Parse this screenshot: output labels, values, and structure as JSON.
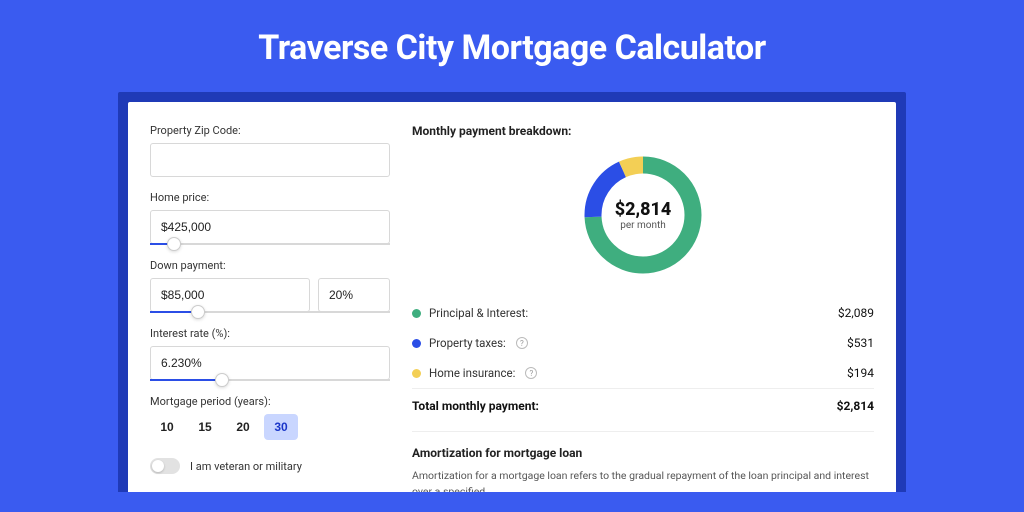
{
  "page": {
    "title": "Traverse City Mortgage Calculator"
  },
  "form": {
    "zip_label": "Property Zip Code:",
    "zip_value": "",
    "home_price_label": "Home price:",
    "home_price_value": "$425,000",
    "home_price_slider_pct": 10,
    "down_payment_label": "Down payment:",
    "down_payment_value": "$85,000",
    "down_payment_pct_value": "20%",
    "down_payment_slider_pct": 20,
    "interest_label": "Interest rate (%):",
    "interest_value": "6.230%",
    "interest_slider_pct": 30,
    "period_label": "Mortgage period (years):",
    "period_options": [
      "10",
      "15",
      "20",
      "30"
    ],
    "period_selected": "30",
    "veteran_label": "I am veteran or military",
    "veteran_on": false
  },
  "breakdown": {
    "title": "Monthly payment breakdown:",
    "center_value": "$2,814",
    "center_sub": "per month",
    "items": [
      {
        "label": "Principal & Interest:",
        "value": "$2,089",
        "color": "#3fae7f",
        "has_help": false
      },
      {
        "label": "Property taxes:",
        "value": "$531",
        "color": "#2b4ee6",
        "has_help": true
      },
      {
        "label": "Home insurance:",
        "value": "$194",
        "color": "#f3cf55",
        "has_help": true
      }
    ],
    "total_label": "Total monthly payment:",
    "total_value": "$2,814"
  },
  "chart_data": {
    "type": "pie",
    "title": "Monthly payment breakdown",
    "series": [
      {
        "name": "Principal & Interest",
        "value": 2089,
        "color": "#3fae7f"
      },
      {
        "name": "Property taxes",
        "value": 531,
        "color": "#2b4ee6"
      },
      {
        "name": "Home insurance",
        "value": 194,
        "color": "#f3cf55"
      }
    ],
    "total": 2814,
    "unit": "USD per month"
  },
  "amortization": {
    "title": "Amortization for mortgage loan",
    "body": "Amortization for a mortgage loan refers to the gradual repayment of the loan principal and interest over a specified"
  }
}
